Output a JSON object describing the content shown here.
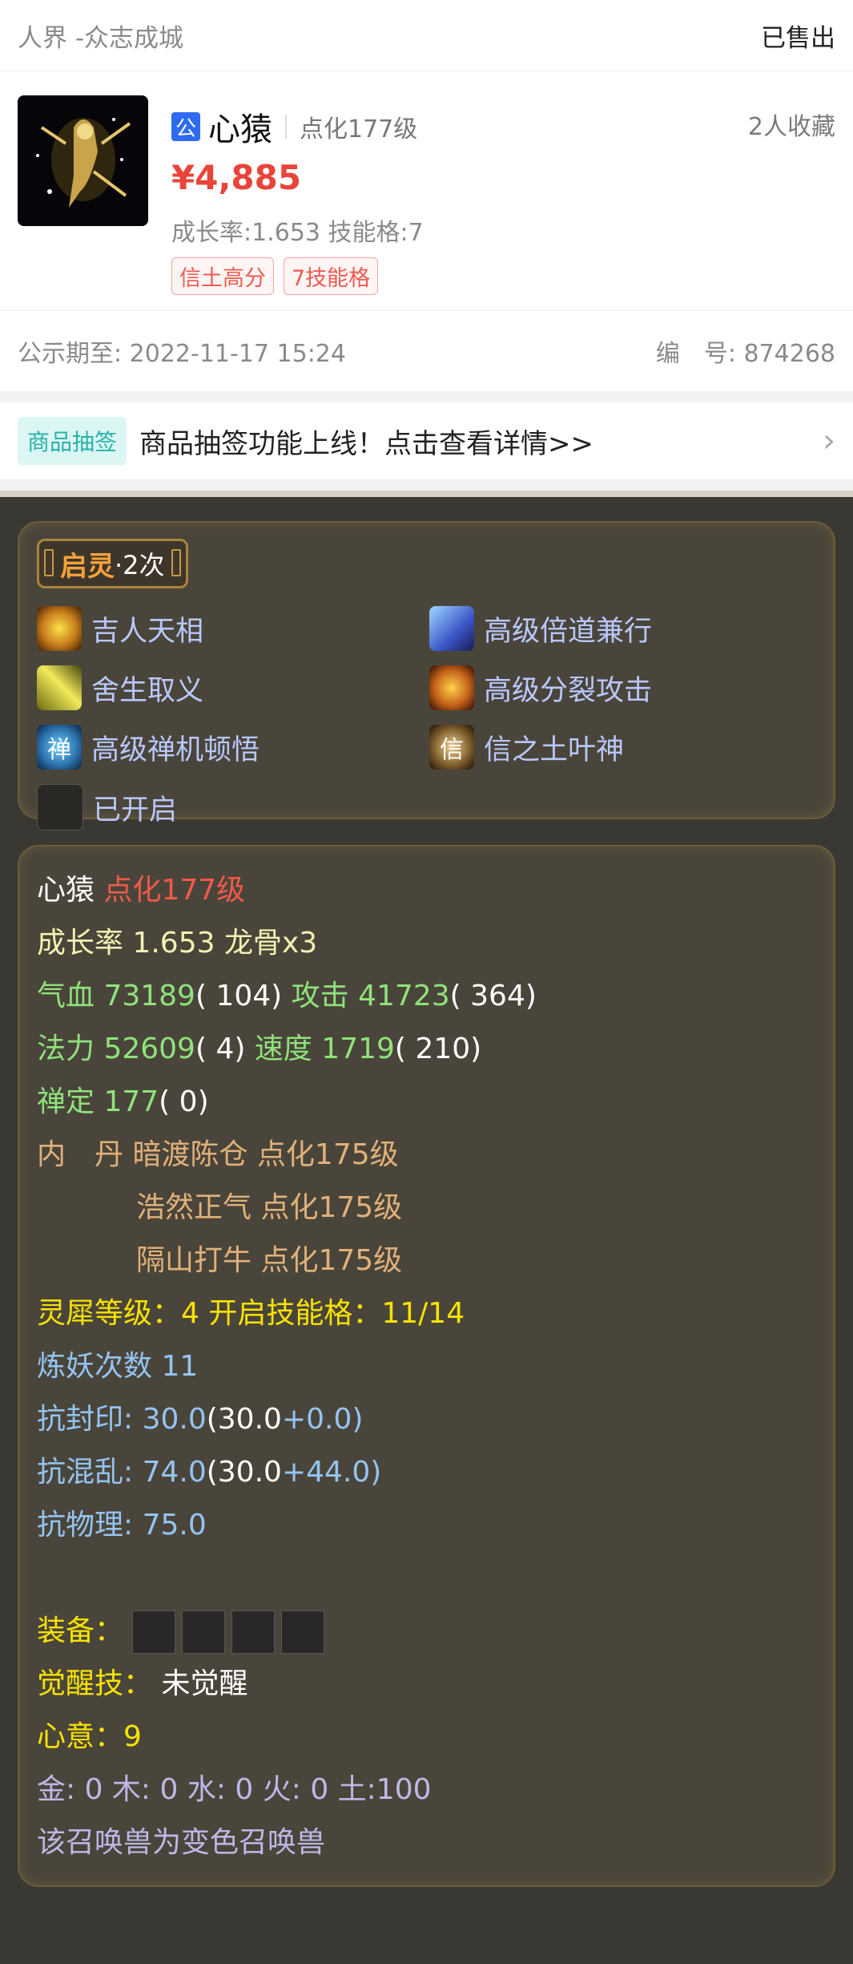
{
  "header": {
    "server": "人界 -众志成城",
    "status": "已售出"
  },
  "item": {
    "gong_badge": "公",
    "name": "心猿",
    "level": "点化177级",
    "favorites": "2人收藏",
    "price": "¥4,885",
    "growth_line": "成长率:1.653 技能格:7",
    "tags": [
      "信土高分",
      "7技能格"
    ]
  },
  "meta": {
    "public_until": "公示期至: 2022-11-17 15:24",
    "serial": "编　号: 874268"
  },
  "banner": {
    "tag": "商品抽签",
    "text": "商品抽签功能上线！点击查看详情>>",
    "arrow": "›"
  },
  "qiling": {
    "title": "启灵",
    "count": "·2次"
  },
  "skills": [
    {
      "name": "吉人天相",
      "icon": "sun-burst-icon",
      "color": "#c47a1a"
    },
    {
      "name": "高级倍道兼行",
      "icon": "wing-icon",
      "color": "#3b56c8"
    },
    {
      "name": "舍生取义",
      "icon": "comet-icon",
      "color": "#b3a51a"
    },
    {
      "name": "高级分裂攻击",
      "icon": "fire-claw-icon",
      "color": "#c4621a"
    },
    {
      "name": "高级禅机顿悟",
      "icon": "chan-glyph-icon",
      "glyph": "禅",
      "color": "#2a6fa8"
    },
    {
      "name": "信之土叶神",
      "icon": "xin-glyph-icon",
      "glyph": "信",
      "color": "#7a5a2a"
    },
    {
      "name": "已开启",
      "icon": "locked-slot-icon",
      "color": "#2b2926"
    }
  ],
  "stats": {
    "name": "心猿",
    "level": "点化177级",
    "growth_label": "成长率 1.653 龙骨x3",
    "hp_label": "气血 73189",
    "hp_extra": "( 104)",
    "atk_label": "攻击 41723",
    "atk_extra": "( 364)",
    "mp_label": "法力 52609",
    "mp_extra": "( 4)",
    "spd_label": "速度 1719",
    "spd_extra": "( 210)",
    "chan_label": "禅定 177",
    "chan_extra": "( 0)",
    "neidan_label": "内　丹",
    "neidan": [
      "暗渡陈仓 点化175级",
      "浩然正气 点化175级",
      "隔山打牛 点化175级"
    ],
    "lingxi": "灵犀等级：4 开启技能格：11/14",
    "lianyao": "炼妖次数 11",
    "kfy_label": "抗封印: 30.0",
    "kfy_base": "(30.0",
    "kfy_plus": "+0.0)",
    "khl_label": "抗混乱: 74.0",
    "khl_base": "(30.0",
    "khl_plus": "+44.0)",
    "kwl": "抗物理: 75.0",
    "equip_label": "装备：",
    "awaken_label": "觉醒技：",
    "awaken_value": "未觉醒",
    "xinyi": "心意：9",
    "elements": "金: 0 木: 0 水: 0 火: 0 土:100",
    "color_note": "该召唤兽为变色召唤兽"
  }
}
